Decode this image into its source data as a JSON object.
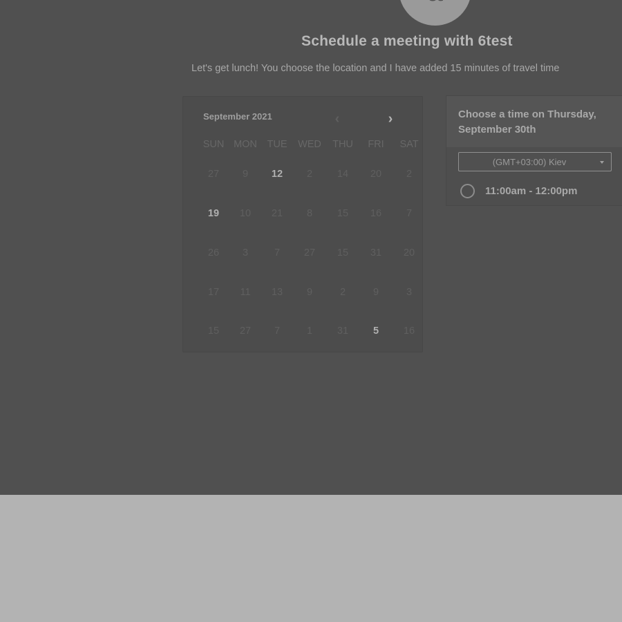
{
  "header": {
    "avatar_letter": "a",
    "title": "Schedule a meeting with 6test",
    "description": "Let's get lunch! You choose the location and I have added 15 minutes of travel time"
  },
  "calendar": {
    "month_label": "September 2021",
    "prev_icon": "chevron-left-icon",
    "next_icon": "chevron-right-icon",
    "days_of_week": [
      "SUN",
      "MON",
      "TUE",
      "WED",
      "THU",
      "FRI",
      "SAT"
    ],
    "weeks": [
      [
        {
          "d": "27",
          "a": false
        },
        {
          "d": "9",
          "a": false
        },
        {
          "d": "12",
          "a": true
        },
        {
          "d": "2",
          "a": false
        },
        {
          "d": "14",
          "a": false
        },
        {
          "d": "20",
          "a": false
        },
        {
          "d": "2",
          "a": false
        }
      ],
      [
        {
          "d": "19",
          "a": true
        },
        {
          "d": "10",
          "a": false
        },
        {
          "d": "21",
          "a": false
        },
        {
          "d": "8",
          "a": false
        },
        {
          "d": "15",
          "a": false
        },
        {
          "d": "16",
          "a": false
        },
        {
          "d": "7",
          "a": false
        }
      ],
      [
        {
          "d": "26",
          "a": false
        },
        {
          "d": "3",
          "a": false
        },
        {
          "d": "7",
          "a": false
        },
        {
          "d": "27",
          "a": false
        },
        {
          "d": "15",
          "a": false
        },
        {
          "d": "31",
          "a": false
        },
        {
          "d": "20",
          "a": false
        }
      ],
      [
        {
          "d": "17",
          "a": false
        },
        {
          "d": "11",
          "a": false
        },
        {
          "d": "13",
          "a": false
        },
        {
          "d": "9",
          "a": false
        },
        {
          "d": "2",
          "a": false
        },
        {
          "d": "9",
          "a": false
        },
        {
          "d": "3",
          "a": false
        }
      ],
      [
        {
          "d": "15",
          "a": false
        },
        {
          "d": "27",
          "a": false
        },
        {
          "d": "7",
          "a": false
        },
        {
          "d": "1",
          "a": false
        },
        {
          "d": "31",
          "a": false
        },
        {
          "d": "5",
          "a": true
        },
        {
          "d": "16",
          "a": false
        }
      ]
    ]
  },
  "time_panel": {
    "heading": "Choose a time on Thursday, September 30th",
    "timezone": "(GMT+03:00) Kiev",
    "slots": [
      {
        "label": "11:00am - 12:00pm",
        "selected": false
      }
    ]
  }
}
